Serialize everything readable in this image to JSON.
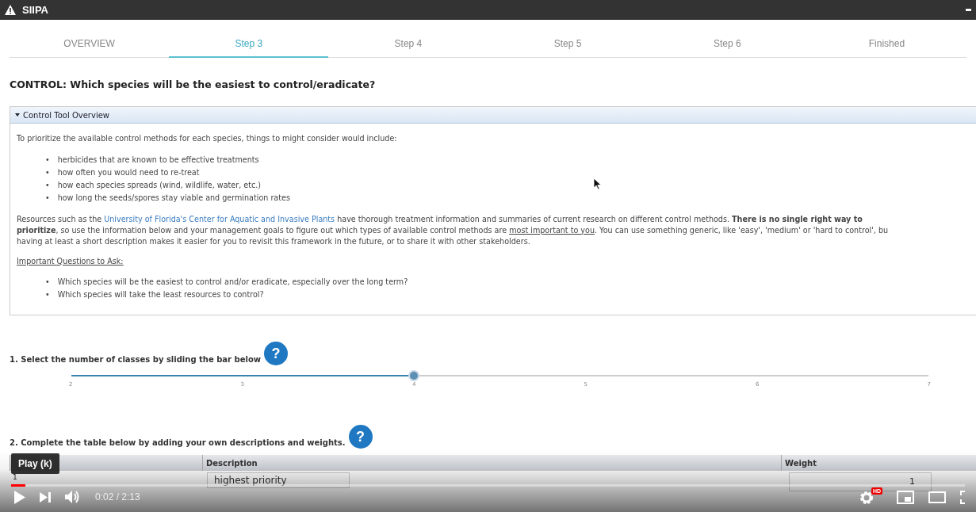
{
  "window": {
    "title": "SIIPA"
  },
  "tabs": [
    {
      "label": "OVERVIEW",
      "selected": false
    },
    {
      "label": "Step 3",
      "selected": true
    },
    {
      "label": "Step 4",
      "selected": false
    },
    {
      "label": "Step 5",
      "selected": false
    },
    {
      "label": "Step 6",
      "selected": false
    },
    {
      "label": "Finished",
      "selected": false
    }
  ],
  "heading": "CONTROL: Which species will be the easiest to control/eradicate?",
  "overview_panel": {
    "title": "Control Tool Overview",
    "expanded": true,
    "bullet": "•",
    "intro": "To prioritize the available control methods for each species, things to might consider would include:",
    "considerations": [
      "herbicides that are known to be effective treatments",
      "how often you would need to re-treat",
      "how each species spreads (wind, wildlife, water, etc.)",
      "how long the seeds/spores stay viable and germination rates"
    ],
    "paragraph": [
      {
        "kind": "text",
        "text": "Resources such as the "
      },
      {
        "kind": "link",
        "text": "University of Florida's Center for Aquatic and Invasive Plants"
      },
      {
        "kind": "text",
        "text": " have thorough treatment information and summaries of current research on different control methods. "
      },
      {
        "kind": "bold",
        "text": "There is no single right way to"
      },
      {
        "kind": "break"
      },
      {
        "kind": "bold",
        "text": "prioritize"
      },
      {
        "kind": "text",
        "text": ", so use the information below and your management goals to figure out which types of available control methods are "
      },
      {
        "kind": "underline",
        "text": "most important to you"
      },
      {
        "kind": "text",
        "text": ". You can use something generic, like 'easy', 'medium' or 'hard to control', bu"
      },
      {
        "kind": "break"
      },
      {
        "kind": "text",
        "text": "having at least a short description makes it easier for you to revisit this framework in the future, or to share it with other stakeholders."
      }
    ],
    "questions_title": "Important Questions to Ask:",
    "questions": [
      "Which species will be the easiest to control and/or eradicate, especially over the long term?",
      "Which species will take the least resources to control?"
    ]
  },
  "classes_step": {
    "label": "1. Select the number of classes by sliding the bar below",
    "help": "?",
    "level": 0.4,
    "ticks": [
      "2",
      "3",
      "4",
      "5",
      "6",
      "7"
    ]
  },
  "table_step": {
    "label": "2. Complete the table below by adding your own descriptions and weights.",
    "help": "?"
  },
  "table": {
    "columns": [
      "Description",
      "Weight"
    ],
    "rows": [
      {
        "index": "1",
        "description": "highest priority",
        "weight": "1"
      }
    ]
  },
  "player": {
    "tooltip": "Play (k)",
    "time": "0:02 / 2:13",
    "level": 0.015,
    "quality_badge": "HD"
  }
}
